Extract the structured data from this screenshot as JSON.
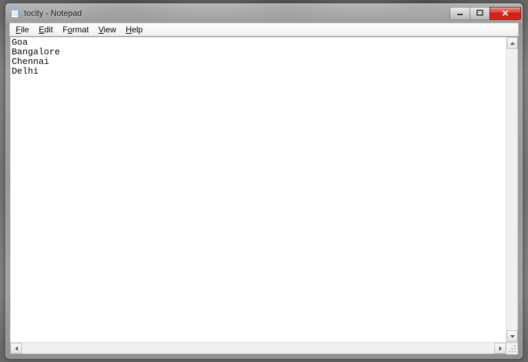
{
  "window": {
    "title": "tocity - Notepad"
  },
  "menu": {
    "file": {
      "underline": "F",
      "rest": "ile"
    },
    "edit": {
      "underline": "E",
      "rest": "dit"
    },
    "format": {
      "underline": "o",
      "pre": "F",
      "rest": "rmat"
    },
    "view": {
      "underline": "V",
      "rest": "iew"
    },
    "help": {
      "underline": "H",
      "rest": "elp"
    }
  },
  "editor": {
    "content": "Goa\nBangalore\nChennai\nDelhi"
  }
}
